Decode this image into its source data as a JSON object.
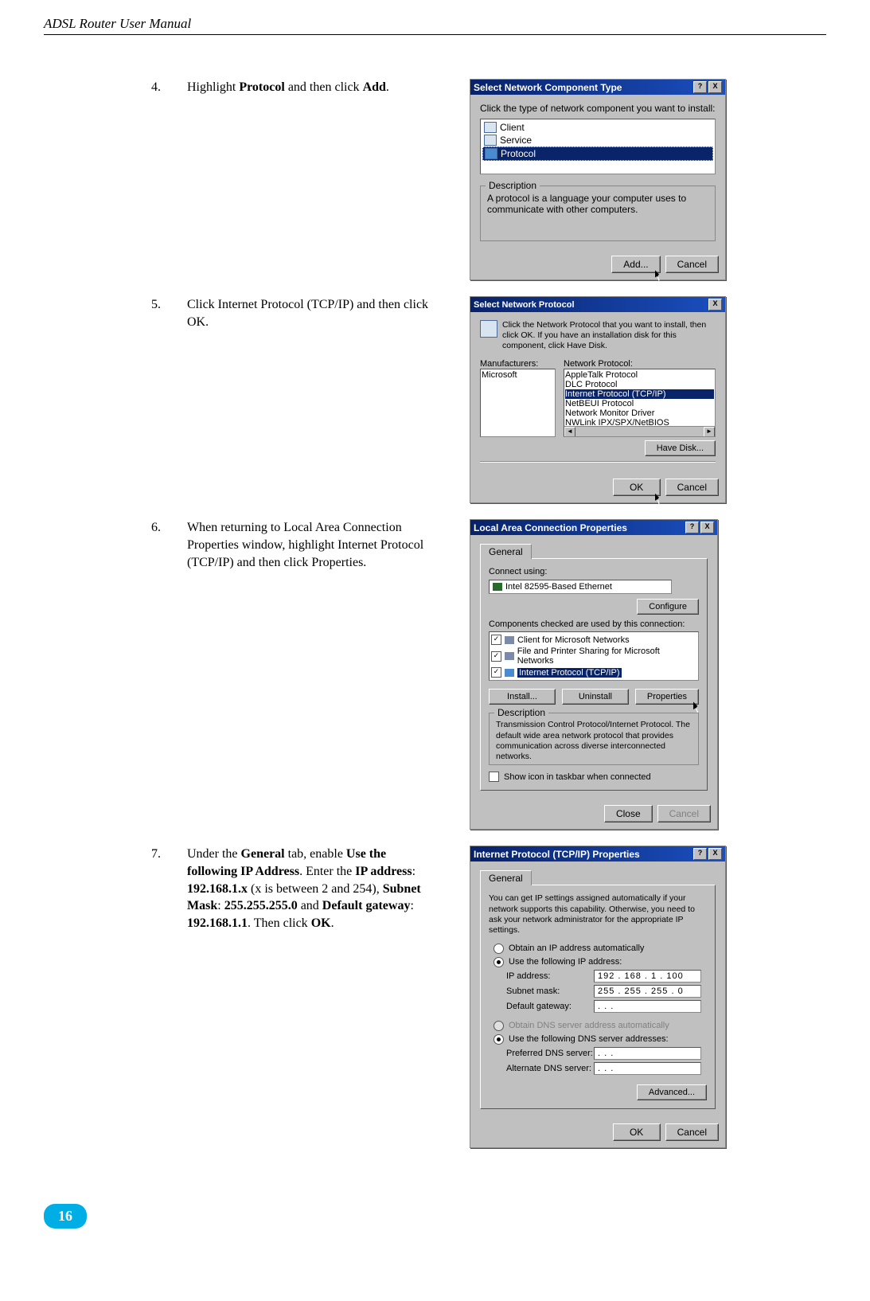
{
  "header": {
    "title": "ADSL Router User Manual"
  },
  "page_number": "16",
  "steps": {
    "s4": {
      "num": "4.",
      "pre": "Highlight ",
      "b1": "Protocol",
      "mid": " and then click ",
      "b2": "Add",
      "post": "."
    },
    "s5": {
      "num": "5.",
      "text": "Click Internet Protocol (TCP/IP) and then click OK."
    },
    "s6": {
      "num": "6.",
      "text": "When returning to Local Area Connection Properties window, highlight Internet Protocol (TCP/IP) and then click Properties."
    },
    "s7": {
      "num": "7.",
      "p1": "Under the ",
      "b_general": "General",
      "p2": " tab, enable ",
      "b_use": "Use the following IP Address",
      "p3": ". Enter the ",
      "b_ipaddr": "IP address",
      "p4": ": ",
      "b_ip": "192.168.1.x",
      "p5": " (x is between 2 and 254), ",
      "b_subnetlbl": "Subnet Mask",
      "p6": ": ",
      "b_subnet": "255.255.255.0",
      "p7": " and ",
      "b_gwlbl": "Default gateway",
      "p8": ": ",
      "b_gw": "192.168.1.1",
      "p9": ". Then click ",
      "b_ok": "OK",
      "p10": "."
    }
  },
  "dlg1": {
    "title": "Select Network Component Type",
    "help": "?",
    "close": "X",
    "prompt": "Click the type of network component you want to install:",
    "items": {
      "client": "Client",
      "service": "Service",
      "protocol": "Protocol"
    },
    "desc_label": "Description",
    "desc_text": "A protocol is a language your computer uses to communicate with other computers.",
    "add": "Add...",
    "cancel": "Cancel"
  },
  "dlg2": {
    "title": "Select Network Protocol",
    "close": "X",
    "prompt": "Click the Network Protocol that you want to install, then click OK. If you have an installation disk for this component, click Have Disk.",
    "manuf_label": "Manufacturers:",
    "netp_label": "Network Protocol:",
    "manuf_item": "Microsoft",
    "np": {
      "a": "AppleTalk Protocol",
      "b": "DLC Protocol",
      "c": "Internet Protocol (TCP/IP)",
      "d": "NetBEUI Protocol",
      "e": "Network Monitor Driver",
      "f": "NWLink IPX/SPX/NetBIOS Compatible Transport Pr"
    },
    "have_disk": "Have Disk...",
    "ok": "OK",
    "cancel": "Cancel"
  },
  "dlg3": {
    "title": "Local Area Connection Properties",
    "help": "?",
    "close": "X",
    "tab": "General",
    "connect_using": "Connect using:",
    "nic": "Intel 82595-Based Ethernet",
    "configure": "Configure",
    "components_label": "Components checked are used by this connection:",
    "comp": {
      "a": "Client for Microsoft Networks",
      "b": "File and Printer Sharing for Microsoft Networks",
      "c": "Internet Protocol (TCP/IP)"
    },
    "install": "Install...",
    "uninstall": "Uninstall",
    "properties": "Properties",
    "desc_label": "Description",
    "desc_text": "Transmission Control Protocol/Internet Protocol. The default wide area network protocol that provides communication across diverse interconnected networks.",
    "show_tray": "Show icon in taskbar when connected",
    "close_btn": "Close",
    "cancel": "Cancel"
  },
  "dlg4": {
    "title": "Internet Protocol (TCP/IP) Properties",
    "help": "?",
    "close": "X",
    "tab": "General",
    "blurb": "You can get IP settings assigned automatically if your network supports this capability. Otherwise, you need to ask your network administrator for the appropriate IP settings.",
    "r1": "Obtain an IP address automatically",
    "r2": "Use the following IP address:",
    "ip_label": "IP address:",
    "ip_val": "192 . 168 .   1   . 100",
    "sm_label": "Subnet mask:",
    "sm_val": "255 . 255 . 255 .   0",
    "gw_label": "Default gateway:",
    "gw_val": " .       .       . ",
    "r3": "Obtain DNS server address automatically",
    "r4": "Use the following DNS server addresses:",
    "pdns_label": "Preferred DNS server:",
    "adns_label": "Alternate DNS server:",
    "dns_blank": " .       .       . ",
    "advanced": "Advanced...",
    "ok": "OK",
    "cancel": "Cancel"
  }
}
